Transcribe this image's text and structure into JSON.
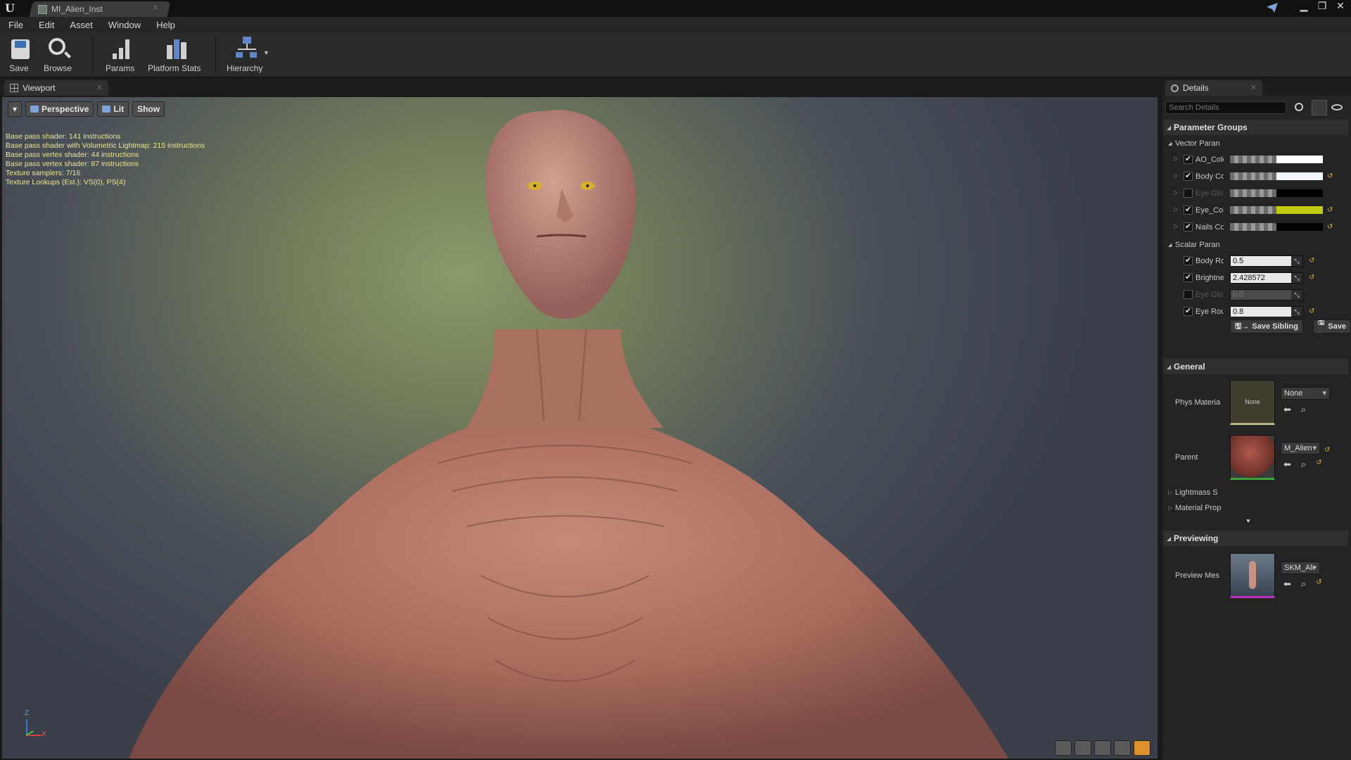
{
  "window": {
    "tab_title": "MI_Alien_Inst"
  },
  "menu": [
    "File",
    "Edit",
    "Asset",
    "Window",
    "Help"
  ],
  "toolbar": {
    "save": "Save",
    "browse": "Browse",
    "params": "Params",
    "platform_stats": "Platform Stats",
    "hierarchy": "Hierarchy"
  },
  "viewport": {
    "tab_label": "Viewport",
    "perspective": "Perspective",
    "lit": "Lit",
    "show": "Show",
    "stats": [
      "Base pass shader: 141 instructions",
      "Base pass shader with Volumetric Lightmap: 215 instructions",
      "Base pass vertex shader: 44 instructions",
      "Base pass vertex shader: 87 instructions",
      "Texture samplers: 7/16",
      "Texture Lookups (Est.): VS(0), PS(4)"
    ],
    "axis_z": "Z",
    "axis_x": "X"
  },
  "details": {
    "tab_label": "Details",
    "search_placeholder": "Search Details",
    "parameter_groups": "Parameter Groups",
    "vector_params": "Vector Paran",
    "vector_rows": [
      {
        "label": "AO_Colo",
        "enabled": true,
        "color": "#ffffff"
      },
      {
        "label": "Body Co",
        "enabled": true,
        "color": "#ffffff"
      },
      {
        "label": "Eye Glo",
        "enabled": false,
        "color": "#000000"
      },
      {
        "label": "Eye_Col",
        "enabled": true,
        "color": "#c2cc10"
      },
      {
        "label": "Nails Co",
        "enabled": true,
        "color": "#000000"
      }
    ],
    "scalar_params": "Scalar Paran",
    "scalar_rows": [
      {
        "label": "Body Ro",
        "enabled": true,
        "value": "0.5"
      },
      {
        "label": "Brightne",
        "enabled": true,
        "value": "2.428572"
      },
      {
        "label": "Eye Glo",
        "enabled": false,
        "value": "0.0"
      },
      {
        "label": "Eye Rou",
        "enabled": true,
        "value": "0.8"
      }
    ],
    "save_sibling": "Save Sibling",
    "save_child": "Save",
    "general": "General",
    "phys_material_label": "Phys Materia",
    "phys_material_thumb": "None",
    "phys_material_value": "None",
    "parent_label": "Parent",
    "parent_value": "M_Alien",
    "lightmass": "Lightmass S",
    "material_props": "Material Prop",
    "previewing": "Previewing",
    "preview_mesh_label": "Preview Mes",
    "preview_mesh_value": "SKM_Ali"
  }
}
